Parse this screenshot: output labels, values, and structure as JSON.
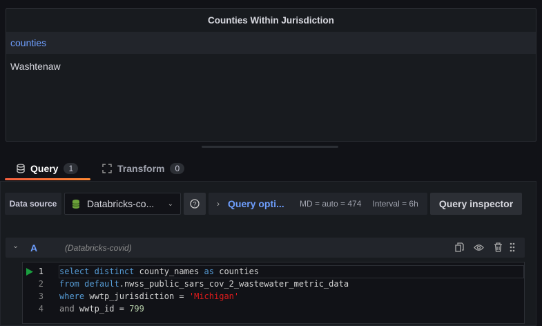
{
  "panel": {
    "title": "Counties Within Jurisdiction",
    "column": "counties",
    "rows": [
      "Washtenaw"
    ]
  },
  "tabs": [
    {
      "label": "Query",
      "count": "1"
    },
    {
      "label": "Transform",
      "count": "0"
    }
  ],
  "toolbar": {
    "data_source_label": "Data source",
    "data_source_value": "Databricks-co...",
    "query_options_label": "Query opti...",
    "md": "MD = auto = 474",
    "interval": "Interval = 6h",
    "inspector_label": "Query inspector"
  },
  "query": {
    "ref_id": "A",
    "datasource": "(Databricks-covid)",
    "lines": [
      {
        "n": "1",
        "t": [
          [
            "kw",
            "select distinct"
          ],
          [
            "",
            "county_names"
          ],
          [
            "kw",
            "as"
          ],
          [
            "",
            "counties"
          ]
        ]
      },
      {
        "n": "2",
        "t": [
          [
            "kw",
            "from"
          ],
          [
            "kw",
            "default"
          ],
          [
            "",
            ".nwss_public_sars_cov_2_wastewater_metric_data"
          ]
        ]
      },
      {
        "n": "3",
        "t": [
          [
            "kw",
            "where"
          ],
          [
            "",
            "wwtp_jurisdiction ="
          ],
          [
            "str",
            "'Michigan'"
          ]
        ]
      },
      {
        "n": "4",
        "t": [
          [
            "gr",
            "and"
          ],
          [
            "",
            "wwtp_id ="
          ],
          [
            "num",
            "799"
          ]
        ]
      }
    ]
  },
  "colors": {
    "accent": "#6e9fff",
    "tab_underline": "#f55f3e",
    "run": "#1a9e3f"
  }
}
